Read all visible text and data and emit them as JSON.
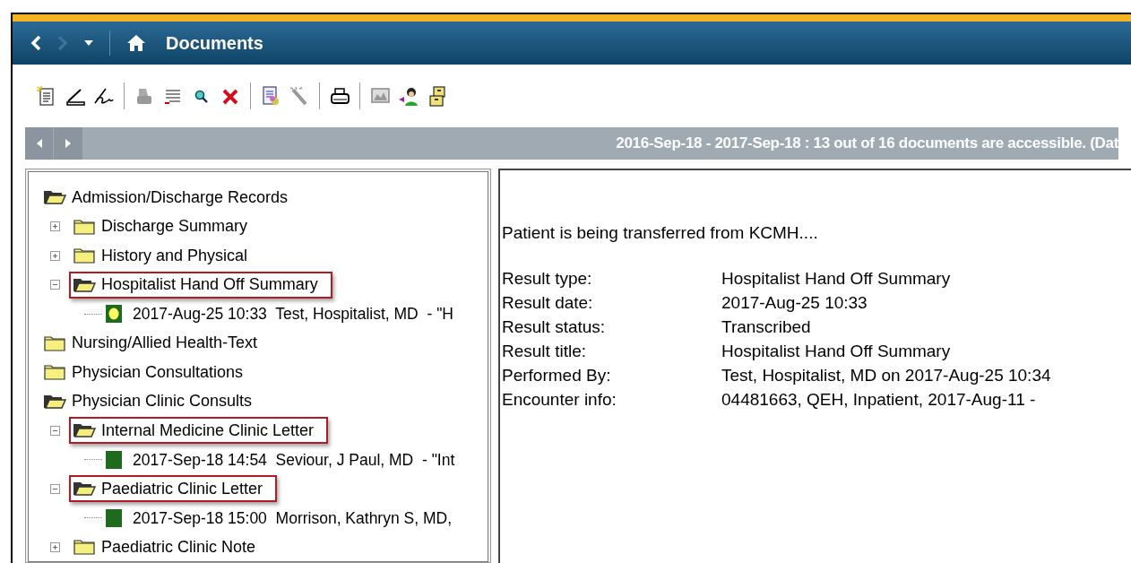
{
  "window": {
    "title": "Documents"
  },
  "filter_bar": {
    "status": "2016-Sep-18 - 2017-Sep-18 : 13 out of 16 documents are accessible. (Dat"
  },
  "tree": [
    {
      "kind": "folder",
      "label": "Admission/Discharge Records",
      "expanded": true,
      "highlighted": false,
      "children": [
        {
          "kind": "folder",
          "label": "Discharge Summary",
          "expanded": false,
          "highlighted": false
        },
        {
          "kind": "folder",
          "label": "History and Physical",
          "expanded": false,
          "highlighted": false
        },
        {
          "kind": "folder",
          "label": "Hospitalist Hand Off Summary",
          "expanded": true,
          "highlighted": true,
          "children": [
            {
              "kind": "document",
              "label": "2017-Aug-25 10:33  Test, Hospitalist, MD  - \"H",
              "color": "#ffff66"
            }
          ]
        }
      ]
    },
    {
      "kind": "folder",
      "label": "Nursing/Allied Health-Text",
      "expanded": false,
      "highlighted": false
    },
    {
      "kind": "folder",
      "label": "Physician Consultations",
      "expanded": false,
      "highlighted": false
    },
    {
      "kind": "folder",
      "label": "Physician Clinic Consults",
      "expanded": true,
      "highlighted": false,
      "children": [
        {
          "kind": "folder",
          "label": "Internal Medicine Clinic Letter",
          "expanded": true,
          "highlighted": true,
          "children": [
            {
              "kind": "document",
              "label": "2017-Sep-18 14:54  Seviour, J Paul, MD  - \"Int",
              "color": "#1e6b1e"
            }
          ]
        },
        {
          "kind": "folder",
          "label": "Paediatric Clinic Letter",
          "expanded": true,
          "highlighted": true,
          "children": [
            {
              "kind": "document",
              "label": "2017-Sep-18 15:00  Morrison, Kathryn S, MD,",
              "color": "#1e6b1e"
            }
          ]
        },
        {
          "kind": "folder",
          "label": "Paediatric Clinic Note",
          "expanded": false,
          "highlighted": false
        }
      ]
    }
  ],
  "document_view": {
    "summary": "Patient is being transferred from KCMH....",
    "fields": [
      {
        "label": "Result type:",
        "value": "Hospitalist Hand Off Summary"
      },
      {
        "label": "Result date:",
        "value": "2017-Aug-25 10:33"
      },
      {
        "label": "Result status:",
        "value": "Transcribed"
      },
      {
        "label": "Result title:",
        "value": "Hospitalist Hand Off Summary"
      },
      {
        "label": "Performed By:",
        "value": "Test, Hospitalist, MD on 2017-Aug-25 10:34"
      },
      {
        "label": "Encounter info:",
        "value": "04481663, QEH, Inpatient, 2017-Aug-11 -"
      }
    ]
  }
}
